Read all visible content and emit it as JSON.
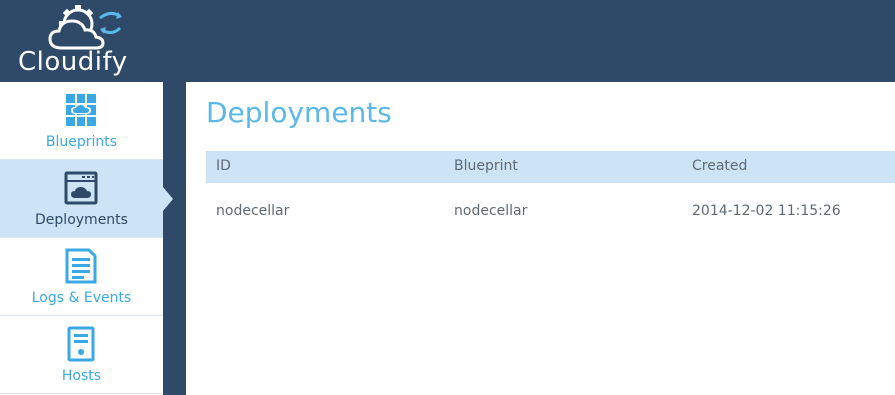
{
  "app": {
    "brand": "Cloudify",
    "logo_icon": "cloud-gears-icon"
  },
  "colors": {
    "header_bg": "#2e4a68",
    "accent": "#3ba8e6",
    "active_bg": "#cce4f6",
    "title": "#5bb8ea"
  },
  "sidebar": {
    "items": [
      {
        "label": "Blueprints",
        "icon": "blueprint-icon",
        "active": false
      },
      {
        "label": "Deployments",
        "icon": "deployment-window-icon",
        "active": true
      },
      {
        "label": "Logs & Events",
        "icon": "document-list-icon",
        "active": false
      },
      {
        "label": "Hosts",
        "icon": "server-icon",
        "active": false
      }
    ]
  },
  "main": {
    "title": "Deployments",
    "table": {
      "columns": [
        "ID",
        "Blueprint",
        "Created"
      ],
      "rows": [
        {
          "id": "nodecellar",
          "blueprint": "nodecellar",
          "created": "2014-12-02 11:15:26"
        }
      ]
    }
  }
}
